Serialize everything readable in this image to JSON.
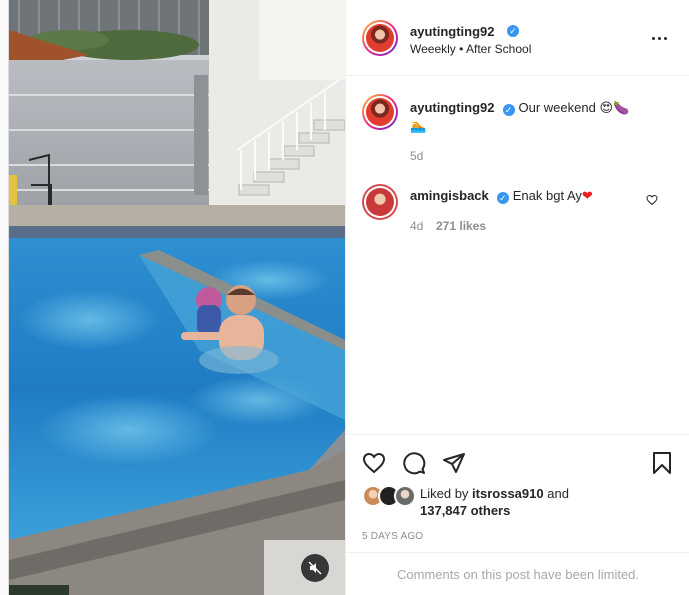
{
  "post": {
    "author": {
      "username": "ayutingting92",
      "verified_icon": "verified-badge-icon",
      "subtitle": "Weeekly • After School"
    },
    "caption": {
      "username": "ayutingting92",
      "text": "Our weekend",
      "emojis": [
        "smiling-face-with-heart-eyes",
        "eggplant-leaf",
        "person-swimming"
      ],
      "age": "5d"
    },
    "comments": [
      {
        "username": "amingisback",
        "text": "Enak bgt Ay",
        "emoji": "red-heart",
        "age": "4d",
        "likes": "271 likes"
      }
    ],
    "actions": {
      "liked_by_prefix": "Liked by",
      "liked_by_user": "itsrossa910",
      "liked_by_and": "and",
      "others": "137,847 others"
    },
    "time_ago": "5 DAYS AGO",
    "comments_limited": "Comments on this post have been limited.",
    "colors": {
      "accent_blue": "#3897f0",
      "heart_red": "#ed1c24",
      "muted_text": "#8e8e8e"
    }
  }
}
